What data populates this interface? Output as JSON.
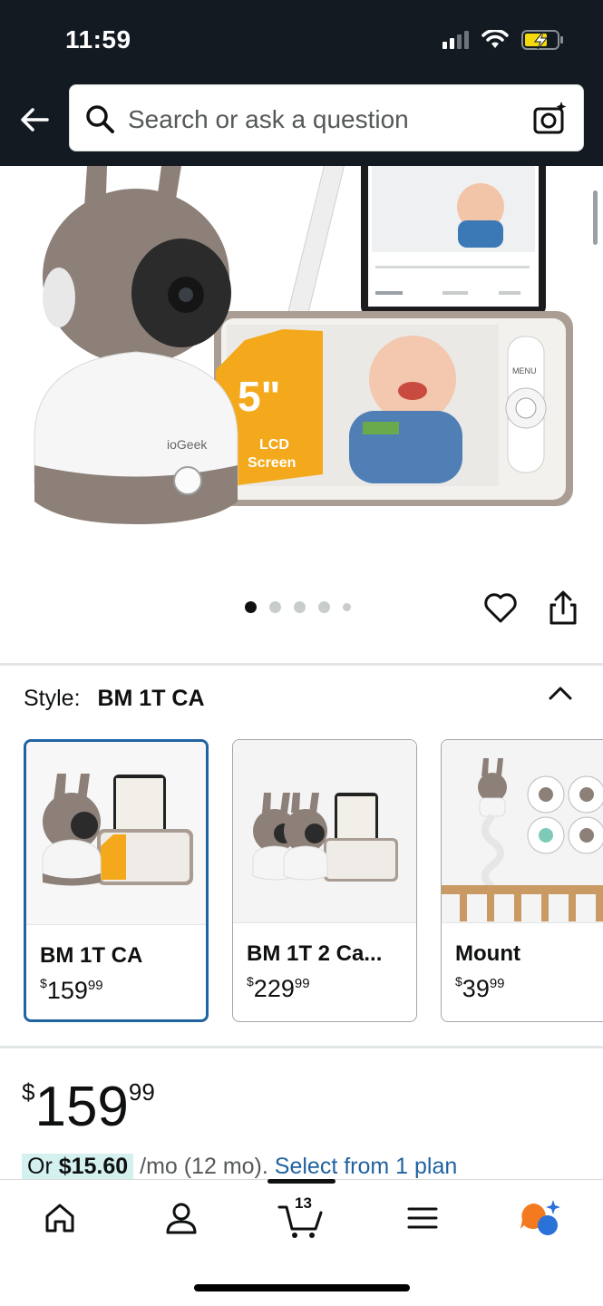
{
  "status_bar": {
    "time": "11:59"
  },
  "search": {
    "placeholder": "Search or ask a question"
  },
  "gallery": {
    "image_count": 5,
    "active_index": 0
  },
  "style": {
    "label": "Style:",
    "selected": "BM 1T CA",
    "options": [
      {
        "name": "BM 1T CA",
        "price_symbol": "$",
        "price_dollars": "159",
        "price_cents": "99",
        "selected": true
      },
      {
        "name": "BM 1T 2 Ca...",
        "price_symbol": "$",
        "price_dollars": "229",
        "price_cents": "99",
        "selected": false
      },
      {
        "name": "Mount",
        "price_symbol": "$",
        "price_dollars": "39",
        "price_cents": "99",
        "selected": false
      }
    ]
  },
  "price": {
    "symbol": "$",
    "dollars": "159",
    "cents": "99",
    "installment_prefix": "Or ",
    "installment_amount": "$15.60",
    "installment_suffix": " /mo (12 mo). ",
    "installment_link": "Select from 1 plan"
  },
  "bottom_nav": {
    "cart_count": "13",
    "items": [
      "home-icon",
      "account-icon",
      "cart-icon",
      "menu-icon",
      "rufus-icon"
    ]
  },
  "colors": {
    "header_bg": "#131a22",
    "link_blue": "#2162a1",
    "selected_border": "#2162a1",
    "installment_highlight": "#d4f1ef",
    "accent_orange": "#f08804"
  }
}
